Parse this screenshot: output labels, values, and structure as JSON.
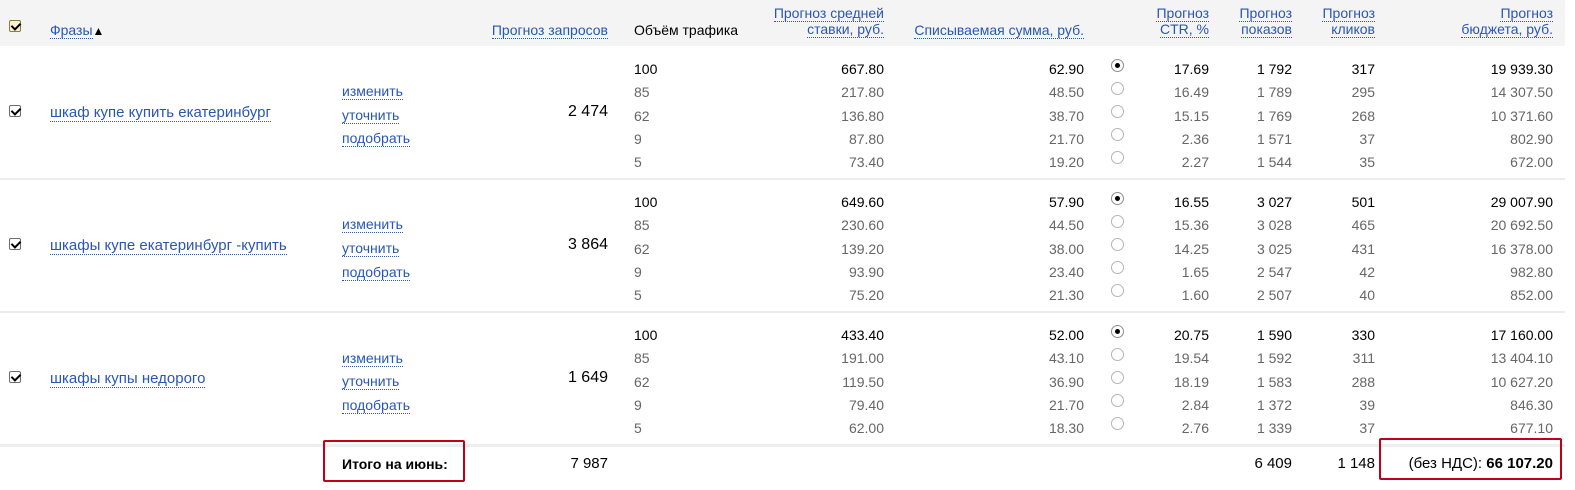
{
  "header": {
    "phrases": "Фразы",
    "sort_arrow": "▲",
    "forecast_requests": "Прогноз запросов",
    "traffic_volume": "Объём трафика",
    "avg_bid_1": "Прогноз средней",
    "avg_bid_2": "ставки, руб.",
    "charged_amount": "Списываемая сумма, руб.",
    "ctr_1": "Прогноз",
    "ctr_2": "CTR, %",
    "impressions_1": "Прогноз",
    "impressions_2": "показов",
    "clicks_1": "Прогноз",
    "clicks_2": "кликов",
    "budget_1": "Прогноз",
    "budget_2": "бюджета, руб."
  },
  "actions": {
    "change": "изменить",
    "refine": "уточнить",
    "pick": "подобрать"
  },
  "groups": [
    {
      "phrase": "шкаф купе купить екатеринбург",
      "requests": "2 474",
      "selected": 0,
      "rows": [
        {
          "volume": "100",
          "bid": "667.80",
          "charge": "62.90",
          "ctr": "17.69",
          "impr": "1 792",
          "clicks": "317",
          "budget": "19 939.30"
        },
        {
          "volume": "85",
          "bid": "217.80",
          "charge": "48.50",
          "ctr": "16.49",
          "impr": "1 789",
          "clicks": "295",
          "budget": "14 307.50"
        },
        {
          "volume": "62",
          "bid": "136.80",
          "charge": "38.70",
          "ctr": "15.15",
          "impr": "1 769",
          "clicks": "268",
          "budget": "10 371.60"
        },
        {
          "volume": "9",
          "bid": "87.80",
          "charge": "21.70",
          "ctr": "2.36",
          "impr": "1 571",
          "clicks": "37",
          "budget": "802.90"
        },
        {
          "volume": "5",
          "bid": "73.40",
          "charge": "19.20",
          "ctr": "2.27",
          "impr": "1 544",
          "clicks": "35",
          "budget": "672.00"
        }
      ]
    },
    {
      "phrase": "шкафы купе екатеринбург -купить",
      "requests": "3 864",
      "selected": 0,
      "rows": [
        {
          "volume": "100",
          "bid": "649.60",
          "charge": "57.90",
          "ctr": "16.55",
          "impr": "3 027",
          "clicks": "501",
          "budget": "29 007.90"
        },
        {
          "volume": "85",
          "bid": "230.60",
          "charge": "44.50",
          "ctr": "15.36",
          "impr": "3 028",
          "clicks": "465",
          "budget": "20 692.50"
        },
        {
          "volume": "62",
          "bid": "139.20",
          "charge": "38.00",
          "ctr": "14.25",
          "impr": "3 025",
          "clicks": "431",
          "budget": "16 378.00"
        },
        {
          "volume": "9",
          "bid": "93.90",
          "charge": "23.40",
          "ctr": "1.65",
          "impr": "2 547",
          "clicks": "42",
          "budget": "982.80"
        },
        {
          "volume": "5",
          "bid": "75.20",
          "charge": "21.30",
          "ctr": "1.60",
          "impr": "2 507",
          "clicks": "40",
          "budget": "852.00"
        }
      ]
    },
    {
      "phrase": "шкафы купы недорого",
      "requests": "1 649",
      "selected": 0,
      "rows": [
        {
          "volume": "100",
          "bid": "433.40",
          "charge": "52.00",
          "ctr": "20.75",
          "impr": "1 590",
          "clicks": "330",
          "budget": "17 160.00"
        },
        {
          "volume": "85",
          "bid": "191.00",
          "charge": "43.10",
          "ctr": "19.54",
          "impr": "1 592",
          "clicks": "311",
          "budget": "13 404.10"
        },
        {
          "volume": "62",
          "bid": "119.50",
          "charge": "36.90",
          "ctr": "18.19",
          "impr": "1 583",
          "clicks": "288",
          "budget": "10 627.20"
        },
        {
          "volume": "9",
          "bid": "79.40",
          "charge": "21.70",
          "ctr": "2.84",
          "impr": "1 372",
          "clicks": "39",
          "budget": "846.30"
        },
        {
          "volume": "5",
          "bid": "62.00",
          "charge": "18.30",
          "ctr": "2.76",
          "impr": "1 339",
          "clicks": "37",
          "budget": "677.10"
        }
      ]
    }
  ],
  "totals": {
    "label": "Итого на июнь:",
    "requests": "7 987",
    "impressions": "6 409",
    "clicks": "1 148",
    "budget_prefix": "(без НДС):",
    "budget": "66 107.20"
  },
  "colors": {
    "link": "#2856b6",
    "highlight_border": "#c0001b"
  }
}
